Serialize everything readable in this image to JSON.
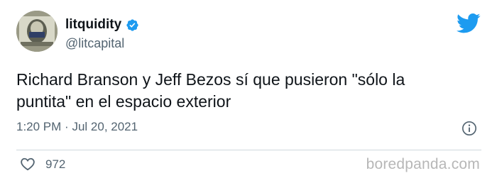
{
  "author": {
    "name": "litquidity",
    "handle": "@litcapital"
  },
  "tweet": {
    "text_line1": "Richard Branson y Jeff Bezos sí que pusieron \"sólo la",
    "text_line2": "puntita\" en el espacio exterior",
    "time": "1:20 PM",
    "separator": "·",
    "date": "Jul 20, 2021",
    "likes": "972"
  },
  "watermark": "boredpanda.com",
  "colors": {
    "twitter_blue": "#1d9bf0",
    "secondary_text": "#536471",
    "divider": "#cfd9de"
  },
  "icons": [
    "avatar-image",
    "verified-badge-icon",
    "twitter-bird-icon",
    "info-icon",
    "heart-icon"
  ]
}
